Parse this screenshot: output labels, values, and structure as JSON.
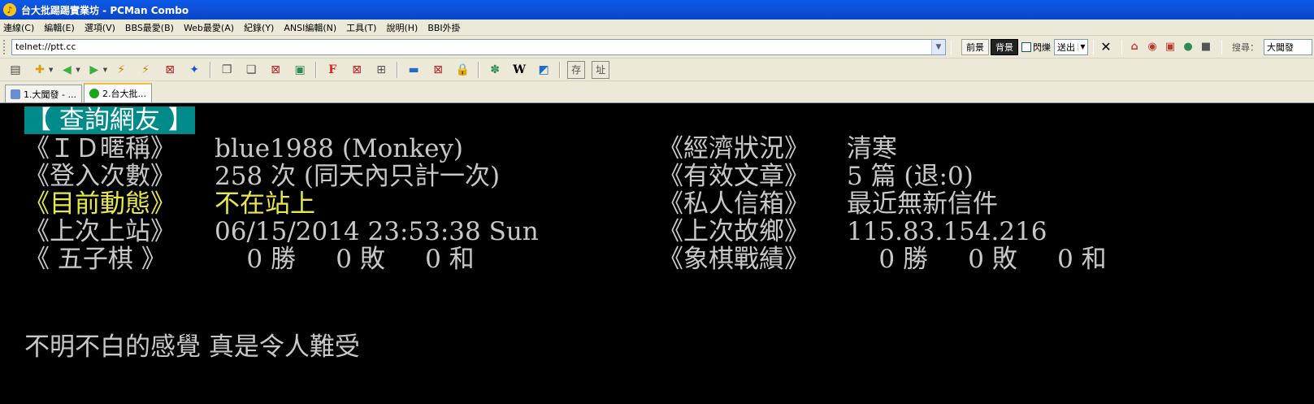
{
  "window": {
    "title": "台大批踢踢實業坊 - PCMan Combo"
  },
  "menu": {
    "items": [
      "連線(C)",
      "編輯(E)",
      "選項(V)",
      "BBS最愛(B)",
      "Web最愛(A)",
      "紀錄(Y)",
      "ANSI編輯(N)",
      "工具(T)",
      "說明(H)",
      "BBI外掛"
    ]
  },
  "address": {
    "url": "telnet://ptt.cc",
    "fg_label": "前景",
    "bg_label": "背景",
    "blink_label": "閃爍",
    "send_label": "送出",
    "search_label": "搜尋：",
    "search_value": "大聞發"
  },
  "tabs": [
    {
      "label": "1.大聞發 - ..."
    },
    {
      "label": "2.台大批..."
    }
  ],
  "terminal": {
    "header": "【 查詢網友 】",
    "rows": [
      {
        "left_label": "《ＩＤ暱稱》",
        "left_value": "blue1988 (Monkey)",
        "right_label": "《經濟狀況》",
        "right_value": "清寒"
      },
      {
        "left_label": "《登入次數》",
        "left_value": "258 次 (同天內只計一次)",
        "right_label": "《有效文章》",
        "right_value": "5 篇 (退:0)"
      },
      {
        "left_label": "《目前動態》",
        "left_value": "不在站上",
        "right_label": "《私人信箱》",
        "right_value": "最近無新信件"
      },
      {
        "left_label": "《上次上站》",
        "left_value": "06/15/2014 23:53:38 Sun",
        "right_label": "《上次故鄉》",
        "right_value": "115.83.154.216"
      },
      {
        "left_label": "《 五子棋 》",
        "left_value": "    0 勝     0 敗     0 和",
        "right_label": "《象棋戰績》",
        "right_value": "    0 勝     0 敗     0 和"
      }
    ],
    "signature": "不明不白的感覺 真是令人難受"
  },
  "colors": {
    "header_bg": "#008b8b",
    "text": "#c8c8c8",
    "highlight": "#e8e84a"
  }
}
